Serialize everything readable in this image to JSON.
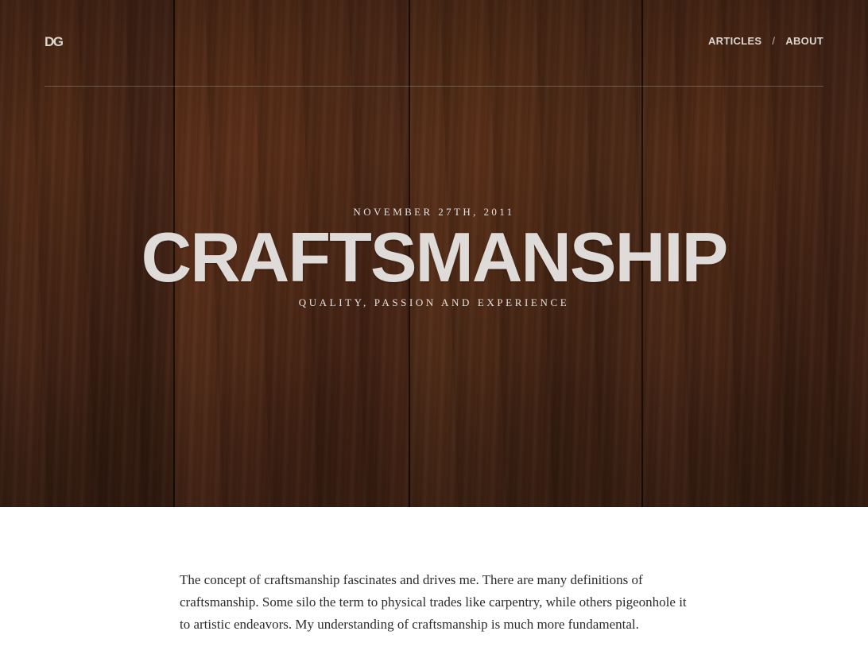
{
  "header": {
    "logo": "DG",
    "nav": [
      {
        "label": "ARTICLES"
      },
      {
        "label": "ABOUT"
      }
    ],
    "separator": "/"
  },
  "hero": {
    "date": "NOVEMBER 27TH, 2011",
    "title": "CRAFTSMANSHIP",
    "subtitle": "QUALITY, PASSION AND EXPERIENCE"
  },
  "article": {
    "paragraph": "The concept of craftsmanship fascinates and drives me. There are many definitions of craftsmanship. Some silo the term to physical trades like carpentry, while others pigeonhole it to artistic endeavors. My understanding of craftsmanship is much more fundamental."
  },
  "colors": {
    "wood": "#55301b",
    "hero_text": "#dedbd8",
    "body_text": "#2b2b2b",
    "background": "#ffffff"
  }
}
